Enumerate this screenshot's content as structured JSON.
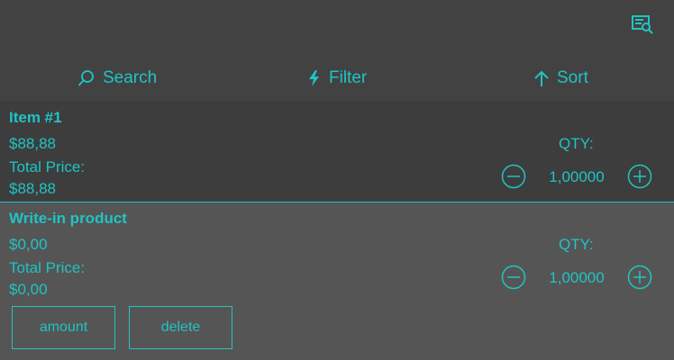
{
  "header": {
    "icon": "dictionary-search-icon"
  },
  "toolbar": {
    "search_label": "Search",
    "filter_label": "Filter",
    "sort_label": "Sort"
  },
  "items": [
    {
      "name": "Item #1",
      "price": "$88,88",
      "total_label": "Total Price:",
      "total_value": "$88,88",
      "qty_label": "QTY:",
      "qty_value": "1,00000"
    },
    {
      "name": "Write-in product",
      "price": "$0,00",
      "total_label": "Total Price:",
      "total_value": "$0,00",
      "qty_label": "QTY:",
      "qty_value": "1,00000",
      "actions": {
        "amount_label": "amount",
        "delete_label": "delete"
      }
    }
  ],
  "colors": {
    "accent": "#1fc4c4",
    "background": "#3d3d3d",
    "selected_row": "#555555"
  }
}
